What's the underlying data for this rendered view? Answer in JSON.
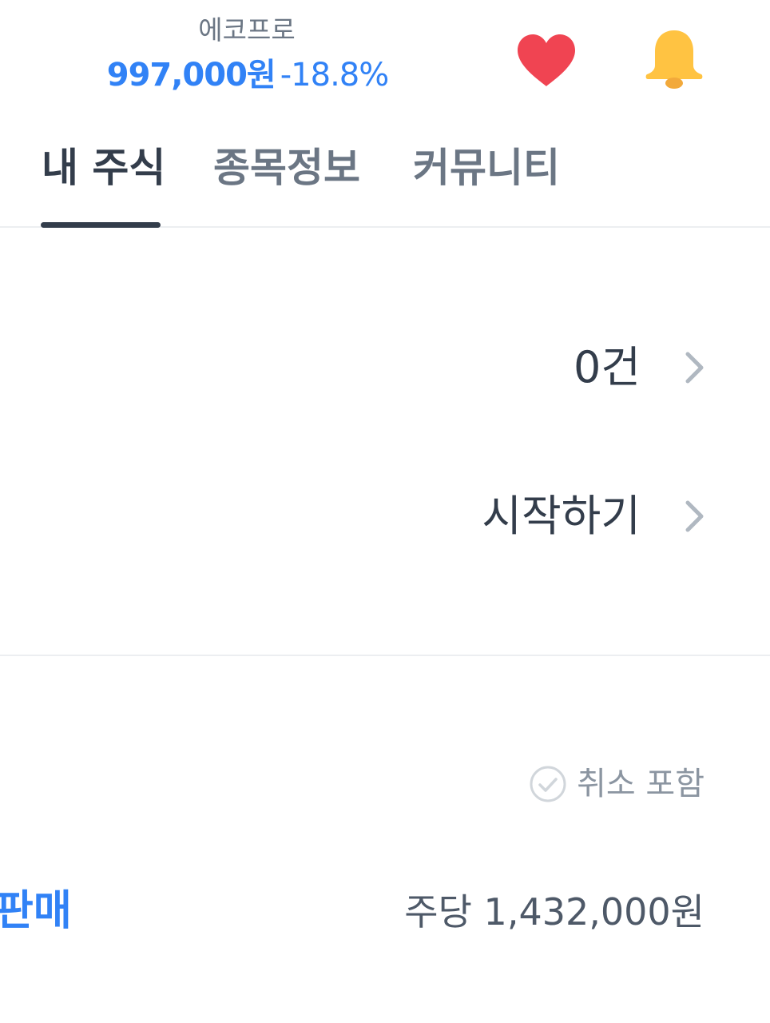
{
  "header": {
    "stock_name": "에코프로",
    "price": "997,000원",
    "change": "-18.8%",
    "icons": {
      "favorite": "heart-icon",
      "alert": "bell-icon"
    },
    "colors": {
      "heart": "#f04452",
      "bell": "#ffc342",
      "price": "#3182f6"
    }
  },
  "tabs": [
    {
      "label": "내 주식",
      "active": true
    },
    {
      "label": "종목정보",
      "active": false
    },
    {
      "label": "커뮤니티",
      "active": false
    }
  ],
  "rows": [
    {
      "value": "0건"
    },
    {
      "value": "시작하기"
    }
  ],
  "history": {
    "cancel_filter_label": "취소 포함",
    "sell_label": "판매",
    "price_per_share": "주당 1,432,000원"
  }
}
